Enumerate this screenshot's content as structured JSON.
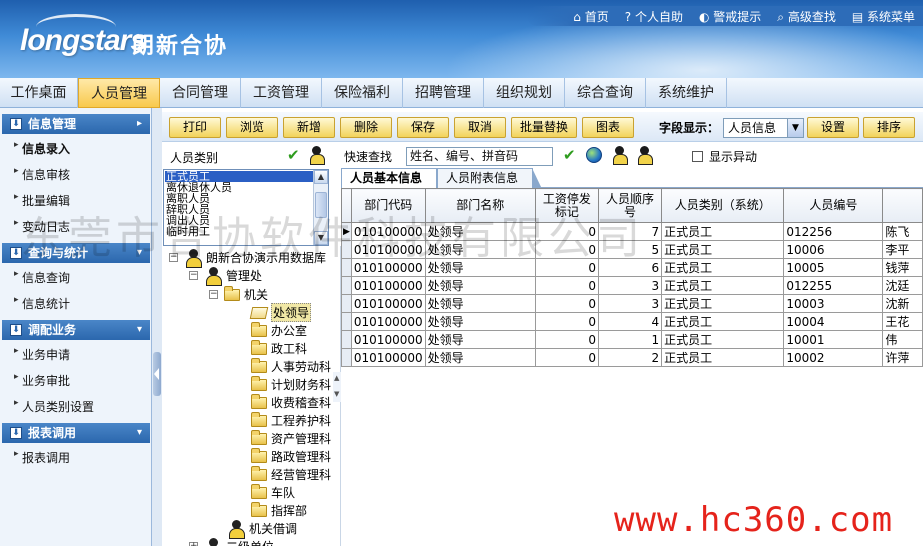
{
  "header": {
    "logo_text": "longstars",
    "logo_cn": "朗新合协",
    "links": [
      "首页",
      "个人自助",
      "警戒提示",
      "高级查找",
      "系统菜单"
    ]
  },
  "menu": [
    "工作桌面",
    "人员管理",
    "合同管理",
    "工资管理",
    "保险福利",
    "招聘管理",
    "组织规划",
    "综合查询",
    "系统维护"
  ],
  "menu_active": "人员管理",
  "sidebar": {
    "sections": [
      {
        "title": "信息管理",
        "items": [
          "信息录入",
          "信息审核",
          "批量编辑",
          "变动日志"
        ]
      },
      {
        "title": "查询与统计",
        "items": [
          "信息查询",
          "信息统计"
        ]
      },
      {
        "title": "调配业务",
        "items": [
          "业务申请",
          "业务审批",
          "人员类别设置"
        ]
      },
      {
        "title": "报表调用",
        "items": [
          "报表调用"
        ]
      }
    ],
    "active_item": "信息录入"
  },
  "toolbar": {
    "buttons": [
      "打印",
      "浏览",
      "新增",
      "删除",
      "保存",
      "取消",
      "批量替换",
      "图表"
    ],
    "field_label": "字段显示：",
    "field_value": "人员信息",
    "settings": "设置",
    "sort": "排序"
  },
  "search": {
    "category_label": "人员类别",
    "quick_label": "快速查找",
    "quick_value": "姓名、编号、拼音码",
    "show_abnormal": "显示异动"
  },
  "category_list": [
    "正式员工",
    "离休退休人员",
    "离职人员",
    "辞职人员",
    "调出人员",
    "临时用工"
  ],
  "tree": {
    "root": "朗新合协演示用数据库",
    "nodes": [
      "管理处",
      "机关",
      "处领导",
      "办公室",
      "政工科",
      "人事劳动科",
      "计划财务科",
      "收费稽查科",
      "工程养护科",
      "资产管理科",
      "路政管理科",
      "经营管理科",
      "车队",
      "指挥部",
      "机关借调",
      "二级单位"
    ]
  },
  "tabs": [
    "人员基本信息",
    "人员附表信息"
  ],
  "grid": {
    "columns": [
      "部门代码",
      "部门名称",
      "工资停发标记",
      "人员顺序号",
      "人员类别（系统）",
      "人员编号",
      ""
    ],
    "rows": [
      [
        "010100000",
        "处领导",
        "0",
        "7",
        "正式员工",
        "012256",
        "陈飞"
      ],
      [
        "010100000",
        "处领导",
        "0",
        "5",
        "正式员工",
        "10006",
        "李平"
      ],
      [
        "010100000",
        "处领导",
        "0",
        "6",
        "正式员工",
        "10005",
        "钱萍"
      ],
      [
        "010100000",
        "处领导",
        "0",
        "3",
        "正式员工",
        "012255",
        "沈廷"
      ],
      [
        "010100000",
        "处领导",
        "0",
        "3",
        "正式员工",
        "10003",
        "沈新"
      ],
      [
        "010100000",
        "处领导",
        "0",
        "4",
        "正式员工",
        "10004",
        "王花"
      ],
      [
        "010100000",
        "处领导",
        "0",
        "1",
        "正式员工",
        "10001",
        "伟"
      ],
      [
        "010100000",
        "处领导",
        "0",
        "2",
        "正式员工",
        "10002",
        "许萍"
      ]
    ]
  },
  "watermark": "东莞市合协软件科技有限公司",
  "watermark2": "www.hc360.com",
  "colors": {
    "header": "#2b6cb8",
    "menu_active": "#f8c94d",
    "button": "#f2d35a",
    "selection": "#2b5fc4"
  }
}
